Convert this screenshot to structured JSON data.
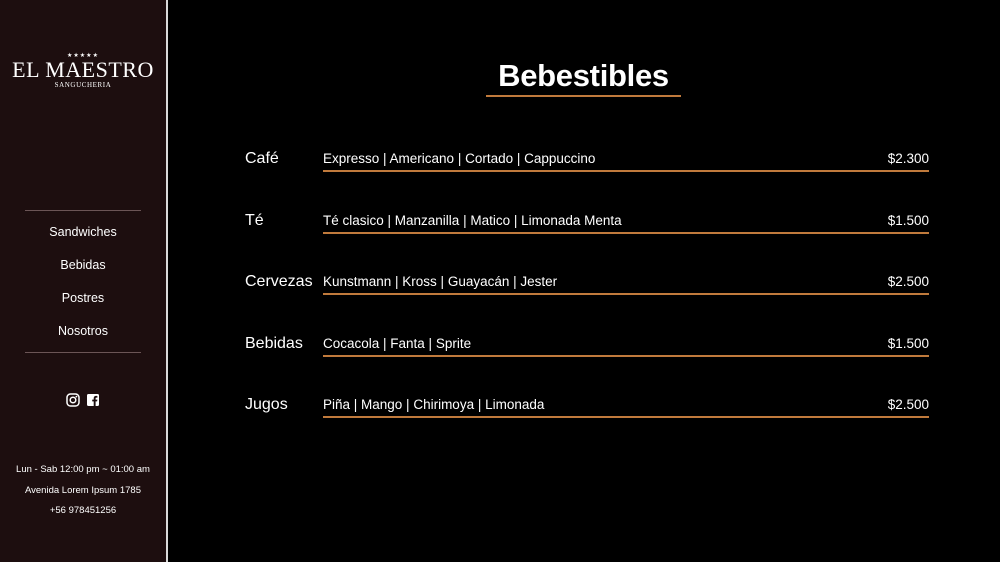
{
  "brand": {
    "stars": "★★★★★",
    "name": "EL MAESTRO",
    "subtitle": "SANGUCHERIA"
  },
  "nav": {
    "items": [
      {
        "label": "Sandwiches"
      },
      {
        "label": "Bebidas"
      },
      {
        "label": "Postres"
      },
      {
        "label": "Nosotros"
      }
    ]
  },
  "social": {
    "icons": [
      "instagram-icon",
      "facebook-icon"
    ]
  },
  "info": {
    "hours": "Lun - Sab 12:00 pm ~ 01:00 am",
    "address": "Avenida Lorem Ipsum 1785",
    "phone": "+56 978451256"
  },
  "main": {
    "title": "Bebestibles",
    "rows": [
      {
        "category": "Café",
        "items": "Expresso | Americano | Cortado | Cappuccino",
        "price": "$2.300"
      },
      {
        "category": "Té",
        "items": "Té clasico | Manzanilla | Matico | Limonada Menta",
        "price": "$1.500"
      },
      {
        "category": "Cervezas",
        "items": "Kunstmann | Kross | Guayacán | Jester",
        "price": "$2.500"
      },
      {
        "category": "Bebidas",
        "items": "Cocacola | Fanta | Sprite",
        "price": "$1.500"
      },
      {
        "category": "Jugos",
        "items": "Piña | Mango | Chirimoya | Limonada",
        "price": "$2.500"
      }
    ]
  },
  "colors": {
    "sidebar_bg": "#1d0e0f",
    "accent": "#c07a3c",
    "page_bg": "#000000"
  }
}
